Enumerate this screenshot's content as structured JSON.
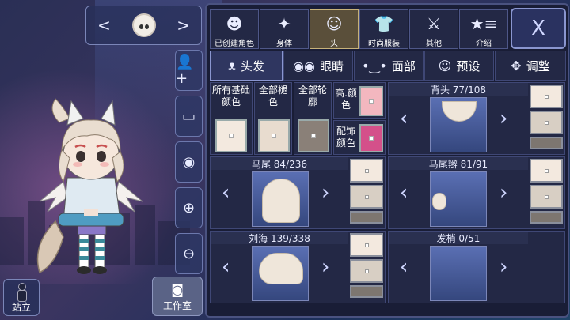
{
  "character_switcher": {
    "prev": "<",
    "next": ">"
  },
  "tools": [
    {
      "name": "add-character-icon",
      "glyph": "👤+"
    },
    {
      "name": "background-image-icon",
      "glyph": "▭"
    },
    {
      "name": "eye-icon",
      "glyph": "◉"
    },
    {
      "name": "zoom-in-icon",
      "glyph": "⊕"
    },
    {
      "name": "zoom-out-icon",
      "glyph": "⊖"
    }
  ],
  "workroom": {
    "label": "工作室"
  },
  "stand": {
    "label": "站立"
  },
  "categories": [
    {
      "label": "已创建角色",
      "glyph": "☻"
    },
    {
      "label": "身体",
      "glyph": "✦"
    },
    {
      "label": "头",
      "glyph": "☺",
      "active": true
    },
    {
      "label": "时尚服装",
      "glyph": "👕"
    },
    {
      "label": "其他",
      "glyph": "⚔"
    },
    {
      "label": "介绍",
      "glyph": "★≡"
    }
  ],
  "close_label": "X",
  "subtabs": [
    {
      "label": "头发",
      "glyph": "ᴥ",
      "active": true
    },
    {
      "label": "眼睛",
      "glyph": "◉◉"
    },
    {
      "label": "面部",
      "glyph": "•‿•"
    },
    {
      "label": "预设",
      "glyph": "☺"
    },
    {
      "label": "调整",
      "glyph": "✥"
    }
  ],
  "colors": {
    "all_base": "所有基础颜色",
    "all_shade": "全部褪色",
    "all_outline": "全部轮廓",
    "highlight": "高.颜色",
    "accessory": "配饰颜色",
    "base_swatch": "#f3e9df",
    "shade_swatch": "#e8dccf",
    "outline_swatch": "#8a8078",
    "highlight_swatch": "#f3b7bf",
    "accessory_swatch": "#d4508a"
  },
  "slots": {
    "back_hair": {
      "title": "背头 77/108"
    },
    "ponytail": {
      "title": "马尾 84/236"
    },
    "pigtails": {
      "title": "马尾辫 81/91"
    },
    "bangs": {
      "title": "刘海 139/338"
    },
    "hair_tips": {
      "title": "发梢 0/51"
    }
  }
}
